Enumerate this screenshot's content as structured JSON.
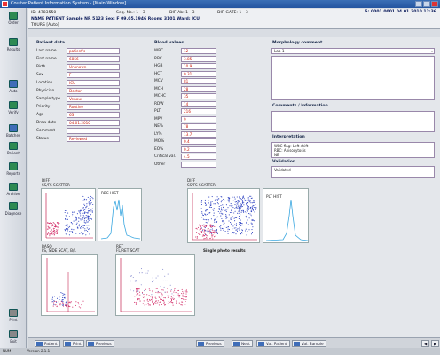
{
  "window": {
    "title": "Coulter Patient Information System - [Main Window]"
  },
  "sidebar": {
    "items": [
      {
        "label": "Order",
        "icon": "order-icon"
      },
      {
        "label": "Results",
        "icon": "results-icon"
      },
      {
        "label": "Auto",
        "icon": "auto-icon"
      },
      {
        "label": "Verify",
        "icon": "verify-icon"
      },
      {
        "label": "Batches",
        "icon": "batch-icon"
      },
      {
        "label": "Patient",
        "icon": "patient-icon"
      },
      {
        "label": "Reports",
        "icon": "report-icon"
      },
      {
        "label": "Archive",
        "icon": "archive-icon"
      },
      {
        "label": "Diagnose",
        "icon": "diagnose-icon"
      },
      {
        "label": "Print",
        "icon": "print-icon"
      },
      {
        "label": "Exit",
        "icon": "exit-icon"
      }
    ]
  },
  "header": {
    "id": "ID: 4783550",
    "seq": "Seq. No.: 1 - 3",
    "dif": "DIF-Ab: 1 - 3",
    "gate": "DIF-GATE: 1 - 3",
    "right": "S: 0001 0001 04.01.2010 12:36",
    "name_line": "NAME PATIENT   Sample NR 5123   Sex: F   09.05.1946   Room: 3101   Ward: ICU",
    "tab": "TOURS [Auto]"
  },
  "left_panel": {
    "title": "Patient data",
    "fields": [
      {
        "label": "Last name",
        "value": "patient's"
      },
      {
        "label": "First name",
        "value": "6856"
      },
      {
        "label": "Birth",
        "value": "Unknown"
      },
      {
        "label": "Sex",
        "value": "F"
      },
      {
        "label": "Location",
        "value": "ICU"
      },
      {
        "label": "Physician",
        "value": "Doctor"
      },
      {
        "label": "Sample type",
        "value": "Venous"
      },
      {
        "label": "Priority",
        "value": "Routine"
      },
      {
        "label": "Age",
        "value": "63"
      },
      {
        "label": "Draw date",
        "value": "04.01.2010"
      },
      {
        "label": "Comment",
        "value": ""
      },
      {
        "label": "Status",
        "value": "Reviewed"
      }
    ]
  },
  "mid_panel": {
    "title": "Blood values",
    "fields": [
      {
        "label": "WBC",
        "value": "12"
      },
      {
        "label": "RBC",
        "value": "3.85"
      },
      {
        "label": "HGB",
        "value": "10.9"
      },
      {
        "label": "HCT",
        "value": "0.31"
      },
      {
        "label": "MCV",
        "value": "81"
      },
      {
        "label": "MCH",
        "value": "28"
      },
      {
        "label": "MCHC",
        "value": "35"
      },
      {
        "label": "RDW",
        "value": "14"
      },
      {
        "label": "PLT",
        "value": "216"
      },
      {
        "label": "MPV",
        "value": "9"
      },
      {
        "label": "NE%",
        "value": "78"
      },
      {
        "label": "LY%",
        "value": "13.7"
      },
      {
        "label": "MO%",
        "value": "0.4"
      },
      {
        "label": "EO%",
        "value": "0.2"
      },
      {
        "label": "Critical val.",
        "value": "4.5"
      },
      {
        "label": "Other",
        "value": ""
      }
    ]
  },
  "right_panel": {
    "title": "Morphology comment",
    "comment_title": "Comments / Information",
    "interpretation_title": "Interpretation",
    "interpretation_lines": [
      "WBC flag: Left shift",
      "RBC: Anisocytosis",
      "NE"
    ],
    "validation_title": "Validation",
    "validation_value": "Validated",
    "select_value": "Lab 1"
  },
  "plots": [
    {
      "title": "DIFF",
      "subtitle": "SS/FS SCATTER"
    },
    {
      "title": "RBC HIST",
      "subtitle": ""
    },
    {
      "title": "DIFF",
      "subtitle": "SS/FS SCATTER"
    },
    {
      "title": "PLT HIST",
      "subtitle": ""
    },
    {
      "title": "BASO",
      "subtitle": "FS, SIDE SCAT, B/L"
    },
    {
      "title": "RET",
      "subtitle": "FL/RET SCAT"
    },
    {
      "title": "Single photo results",
      "subtitle": ""
    }
  ],
  "statusbar": {
    "buttons": [
      {
        "label": "Patient",
        "icon": "patient-icon"
      },
      {
        "label": "Print",
        "icon": "print-icon"
      },
      {
        "label": "Previous",
        "icon": "previous-icon"
      },
      {
        "label": "Previous",
        "icon": "previous-icon"
      },
      {
        "label": "Next",
        "icon": "next-icon"
      },
      {
        "label": "Val. Patient",
        "icon": "validate-icon"
      },
      {
        "label": "Val. Sample",
        "icon": "validate-icon"
      }
    ]
  },
  "bottombar": {
    "left": "NUM",
    "version": "Version 2.1.1"
  },
  "colors": {
    "accent": "#2455a0",
    "red_value": "#c21",
    "scatter_blue": "#2a3fc0",
    "scatter_red": "#d3306a",
    "hist_blue": "#3aa7e0"
  }
}
